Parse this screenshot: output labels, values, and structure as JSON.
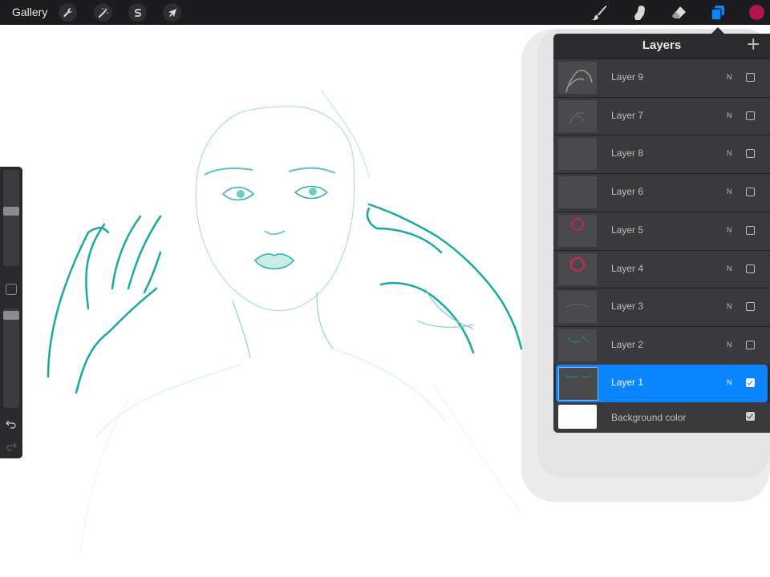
{
  "toolbar": {
    "gallery_label": "Gallery",
    "left_tools": [
      {
        "name": "actions",
        "icon": "wrench-icon"
      },
      {
        "name": "adjustments",
        "icon": "magic-wand-icon"
      },
      {
        "name": "selection",
        "icon": "selection-s-icon"
      },
      {
        "name": "transform",
        "icon": "arrow-cursor-icon"
      }
    ],
    "right_tools": [
      {
        "name": "brush",
        "icon": "brush-icon"
      },
      {
        "name": "smudge",
        "icon": "smudge-finger-icon"
      },
      {
        "name": "eraser",
        "icon": "eraser-icon"
      },
      {
        "name": "layers",
        "icon": "layers-icon",
        "active": true
      }
    ],
    "current_color": "#b0144c",
    "active_color": "#0a84ff"
  },
  "layers_panel": {
    "title": "Layers",
    "add_icon": "plus-icon",
    "layers": [
      {
        "name": "Layer 9",
        "blend": "N",
        "visible": false
      },
      {
        "name": "Layer 7",
        "blend": "N",
        "visible": false
      },
      {
        "name": "Layer 8",
        "blend": "N",
        "visible": false
      },
      {
        "name": "Layer 6",
        "blend": "N",
        "visible": false
      },
      {
        "name": "Layer 5",
        "blend": "N",
        "visible": false
      },
      {
        "name": "Layer 4",
        "blend": "N",
        "visible": false
      },
      {
        "name": "Layer 3",
        "blend": "N",
        "visible": false
      },
      {
        "name": "Layer 2",
        "blend": "N",
        "visible": false
      },
      {
        "name": "Layer 1",
        "blend": "N",
        "visible": true,
        "selected": true
      }
    ],
    "background": {
      "name": "Background color",
      "visible": true,
      "color": "#ffffff"
    }
  },
  "sidebar": {
    "brush_size_level": 0.58,
    "opacity_level": 0.97
  },
  "sketch_color": "#1aa8a0"
}
